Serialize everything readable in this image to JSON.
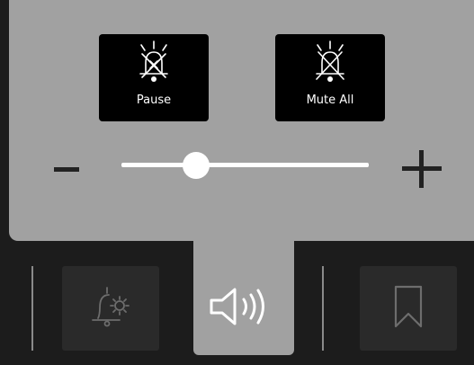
{
  "popup": {
    "pause_label": "Pause",
    "mute_all_label": "Mute All",
    "volume": {
      "minus_symbol": "−",
      "plus_symbol": "+",
      "level_fraction": 0.3
    }
  },
  "nav": {
    "items": [
      {
        "name": "alarm-settings",
        "icon": "bell-gear-icon"
      },
      {
        "name": "sound",
        "icon": "speaker-icon",
        "active": true
      },
      {
        "name": "bookmark",
        "icon": "bookmark-icon"
      }
    ]
  },
  "colors": {
    "panel": "#a1a1a1",
    "background": "#1c1c1c",
    "button": "#000000",
    "nav_button": "#2a2a2a"
  }
}
